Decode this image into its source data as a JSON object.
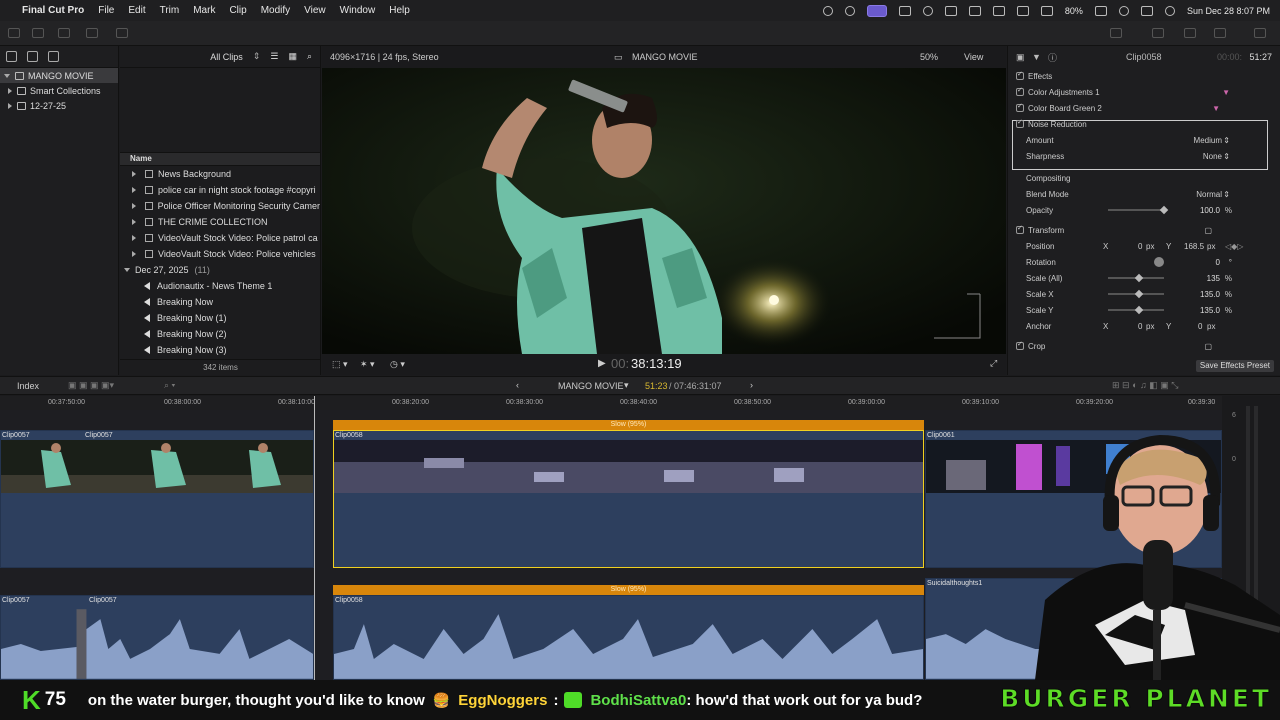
{
  "menubar": {
    "app_name": "Final Cut Pro",
    "items": [
      "File",
      "Edit",
      "Trim",
      "Mark",
      "Clip",
      "Modify",
      "View",
      "Window",
      "Help"
    ],
    "battery": "80%",
    "clock": "Sun Dec 28  8:07 PM"
  },
  "library": {
    "name": "MANGO MOVIE",
    "items": [
      "Smart Collections",
      "12-27-25"
    ]
  },
  "browser": {
    "filter": "All Clips",
    "column_header": "Name",
    "rows": [
      "News Background",
      "police  car in night stock footage #copyri",
      "Police Officer Monitoring Security Camer",
      "THE CRIME COLLECTION",
      "VideoVault Stock Video:   Police patrol ca",
      "VideoVault Stock Video:   Police vehicles"
    ],
    "date_group": "Dec 27, 2025",
    "date_group_count": "(11)",
    "audio_rows": [
      "Audionautix - News Theme 1",
      "Breaking Now",
      "Breaking Now (1)",
      "Breaking Now (2)",
      "Breaking Now (3)"
    ],
    "item_count": "342 items"
  },
  "viewer": {
    "format": "4096×1716 | 24 fps, Stereo",
    "title": "MANGO MOVIE",
    "zoom": "50%",
    "view_label": "View",
    "timecode_dim": "00:",
    "timecode": "38:13:19"
  },
  "inspector": {
    "clip_name": "Clip0058",
    "duration_dim": "00:00:",
    "duration": "51:27",
    "effects_header": "Effects",
    "effects": [
      "Color Adjustments 1",
      "Color Board Green 2",
      "Noise Reduction"
    ],
    "amount_label": "Amount",
    "amount_value": "Medium",
    "sharpness_label": "Sharpness",
    "sharpness_value": "None",
    "compositing_header": "Compositing",
    "blend_label": "Blend Mode",
    "blend_value": "Normal",
    "opacity_label": "Opacity",
    "opacity_value": "100.0",
    "opacity_unit": "%",
    "transform_header": "Transform",
    "position_label": "Position",
    "pos_x_label": "X",
    "pos_x": "0",
    "pos_y_label": "Y",
    "pos_y": "168.5",
    "px": "px",
    "rotation_label": "Rotation",
    "rotation_value": "0",
    "deg": "°",
    "scale_all_label": "Scale (All)",
    "scale_all": "135",
    "scale_x_label": "Scale X",
    "scale_x": "135.0",
    "scale_y_label": "Scale Y",
    "scale_y": "135.0",
    "anchor_label": "Anchor",
    "anchor_x": "0",
    "anchor_y": "0",
    "crop_header": "Crop",
    "save_preset": "Save Effects Preset",
    "opacity_level": 1.0,
    "scale_level": 0.56
  },
  "timeline_bar": {
    "index": "Index",
    "project": "MANGO MOVIE",
    "position": "51:23",
    "total": "07:46:31:07"
  },
  "ruler": [
    "00:37:50:00",
    "00:38:00:00",
    "00:38:10:00",
    "00:38:20:00",
    "00:38:30:00",
    "00:38:40:00",
    "00:38:50:00",
    "00:39:00:00",
    "00:39:10:00",
    "00:39:20:00",
    "00:39:30"
  ],
  "timeline": {
    "clip_a": "Clip0057",
    "clip_a2": "Clip0057",
    "clip_b": "Clip0058",
    "clip_c": "Clip0061",
    "speed": "Slow (95%)",
    "audio_a": "Clip0057",
    "audio_a2": "Clip0057",
    "audio_b": "Clip0058",
    "audio_c": "Suicidalthoughts1",
    "audio_speed": "Slow (95%)"
  },
  "meters": [
    "6",
    "0"
  ],
  "ticker": {
    "k_count": "75",
    "message1": "on the water burger, thought you'd like to know",
    "user1": "EggNoggers",
    "sep": ":",
    "user2": "BodhiSattva0",
    "message2": ": how'd that work out for ya bud?",
    "logo": "BURGER PLANET"
  },
  "colors": {
    "accent_clip": "#2d3f5e",
    "speed_bar": "#d8860b",
    "selection": "#f0d020",
    "ticker_green": "#5ddc26"
  }
}
